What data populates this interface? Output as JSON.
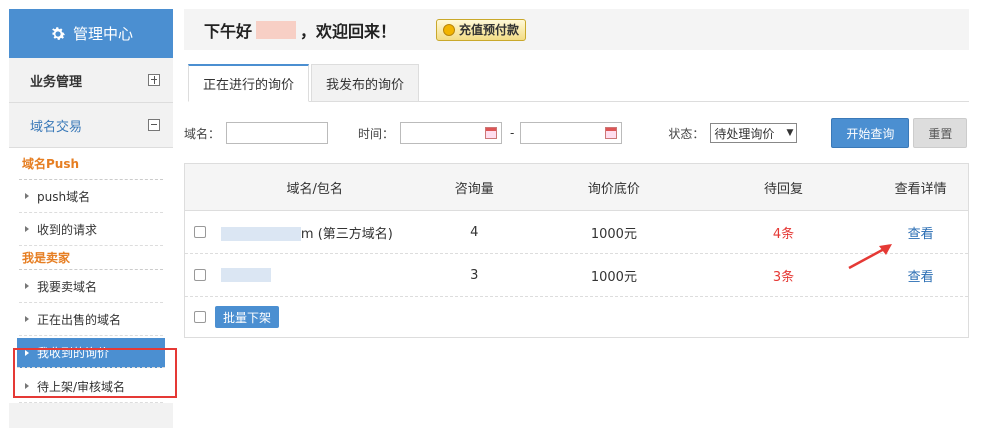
{
  "sidebar": {
    "header": "管理中心",
    "menu": [
      {
        "label": "业务管理",
        "state": "collapsed"
      },
      {
        "label": "域名交易",
        "state": "expanded"
      }
    ],
    "sections": [
      {
        "title": "域名Push",
        "items": [
          "push域名",
          "收到的请求"
        ]
      },
      {
        "title": "我是卖家",
        "items": [
          "我要卖域名",
          "正在出售的域名",
          "我收到的询价",
          "待上架/审核域名"
        ]
      }
    ],
    "selected_item": "我收到的询价"
  },
  "header": {
    "greeting_prefix": "下午好",
    "greeting_suffix": "，欢迎回来！",
    "recharge_button": "充值预付款"
  },
  "tabs": [
    {
      "label": "正在进行的询价",
      "active": true
    },
    {
      "label": "我发布的询价",
      "active": false
    }
  ],
  "search": {
    "domain_label": "域名：",
    "domain_value": "",
    "time_label": "时间：",
    "date_separator": "-",
    "status_label": "状态：",
    "status_value": "待处理询价",
    "search_button": "开始查询",
    "reset_button": "重置"
  },
  "table": {
    "headers": [
      "域名/包名",
      "咨询量",
      "询价底价",
      "待回复",
      "查看详情"
    ],
    "rows": [
      {
        "domain_visible_suffix": "m (第三方域名)",
        "count": "4",
        "price": "1000元",
        "pending": "4条",
        "view": "查看"
      },
      {
        "domain_visible_suffix": "",
        "count": "3",
        "price": "1000元",
        "pending": "3条",
        "view": "查看"
      }
    ],
    "batch_button": "批量下架"
  },
  "colors": {
    "accent": "#4b8fd1",
    "annotation": "#e53935",
    "pending": "#e53935"
  }
}
